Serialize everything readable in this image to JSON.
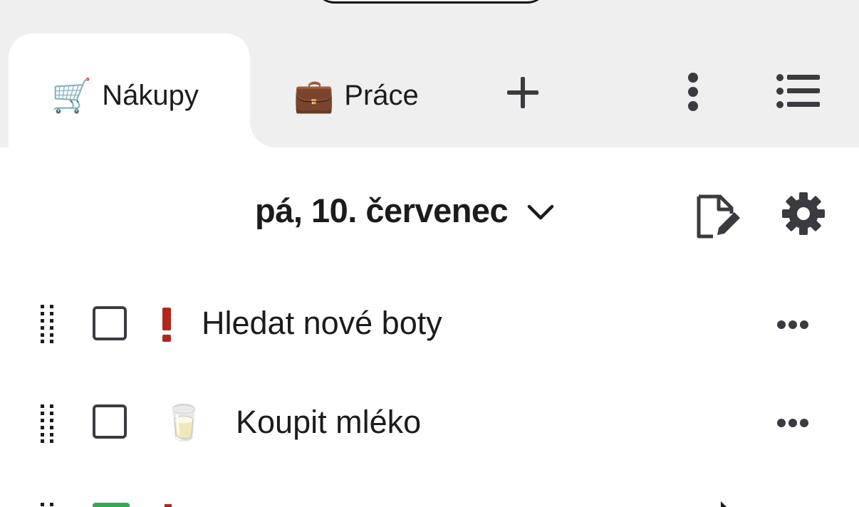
{
  "tabs": [
    {
      "icon": "shopping-cart-icon",
      "emoji": "🛒",
      "label": "Nákupy",
      "active": true
    },
    {
      "icon": "briefcase-icon",
      "emoji": "💼",
      "label": "Práce",
      "active": false
    }
  ],
  "toolbar": {
    "add_icon": "plus-icon",
    "more_icon": "vertical-dots-icon",
    "list_icon": "list-icon"
  },
  "header": {
    "date_label": "pá, 10. červenec",
    "dropdown_icon": "chevron-down-icon",
    "edit_icon": "edit-note-icon",
    "settings_icon": "gear-icon"
  },
  "tasks": [
    {
      "text": "Hledat nové boty",
      "checked": false,
      "priority": "high",
      "priority_icon": "exclamation-icon",
      "priority_color": "#b3261e"
    },
    {
      "text": "Koupit mléko",
      "checked": false,
      "emoji": "🥛",
      "emoji_icon": "milk-glass-icon"
    }
  ],
  "colors": {
    "top_bar": "#efeff0",
    "priority_red": "#b3261e",
    "checkbox_border": "#3a3a40",
    "checked_green": "#34a853"
  }
}
